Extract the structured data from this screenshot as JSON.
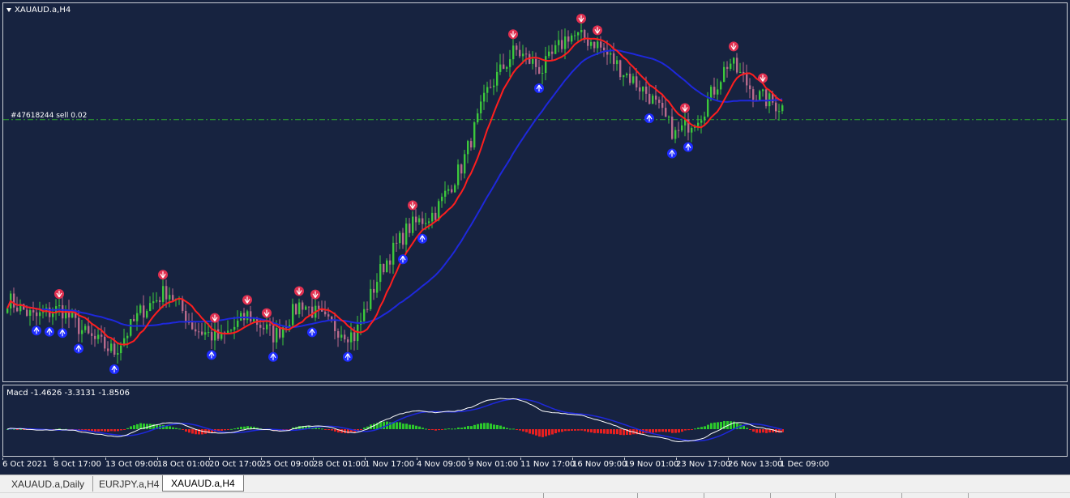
{
  "window": {
    "symbol_title": "XAUAUD.a,H4",
    "order_line_label": "#47618244 sell 0.02",
    "macd_title": "Macd -1.4626 -3.3131 -1.8506"
  },
  "time_axis": {
    "labels": [
      "6 Oct 2021",
      "8 Oct 17:00",
      "13 Oct 09:00",
      "18 Oct 01:00",
      "20 Oct 17:00",
      "25 Oct 09:00",
      "28 Oct 01:00",
      "1 Nov 17:00",
      "4 Nov 09:00",
      "9 Nov 01:00",
      "11 Nov 17:00",
      "16 Nov 09:00",
      "19 Nov 01:00",
      "23 Nov 17:00",
      "26 Nov 13:00",
      "1 Dec 09:00"
    ]
  },
  "tabs": [
    {
      "label": "XAUAUD.a,Daily",
      "active": false
    },
    {
      "label": "EURJPY.a,H4",
      "active": false
    },
    {
      "label": "XAUAUD.a,H4",
      "active": true
    }
  ],
  "colors": {
    "background": "#172340",
    "bull_candle": "#3cc83c",
    "bear_candle": "#b86a8c",
    "fast_ma": "#ff1e1e",
    "slow_ma": "#1e28dc",
    "order_line": "#2ea82e",
    "arrow_up": "#1e2cff",
    "arrow_down": "#e03050",
    "macd_signal": "#ffffff",
    "macd_line": "#1e28dc"
  },
  "chart_data": {
    "type": "candlestick",
    "symbol": "XAUAUD.a",
    "timeframe": "H4",
    "price_anchors": [
      2424,
      2412,
      2418,
      2400,
      2390,
      2416,
      2430,
      2405,
      2398,
      2414,
      2400,
      2422,
      2408,
      2400,
      2444,
      2470,
      2480,
      2510,
      2560,
      2585,
      2572,
      2595,
      2590,
      2572,
      2556,
      2530,
      2545,
      2578,
      2556,
      2548
    ],
    "order_price": 2540,
    "macd": {
      "main": -1.4626,
      "signal": -3.3131,
      "histogram": -1.8506
    }
  }
}
